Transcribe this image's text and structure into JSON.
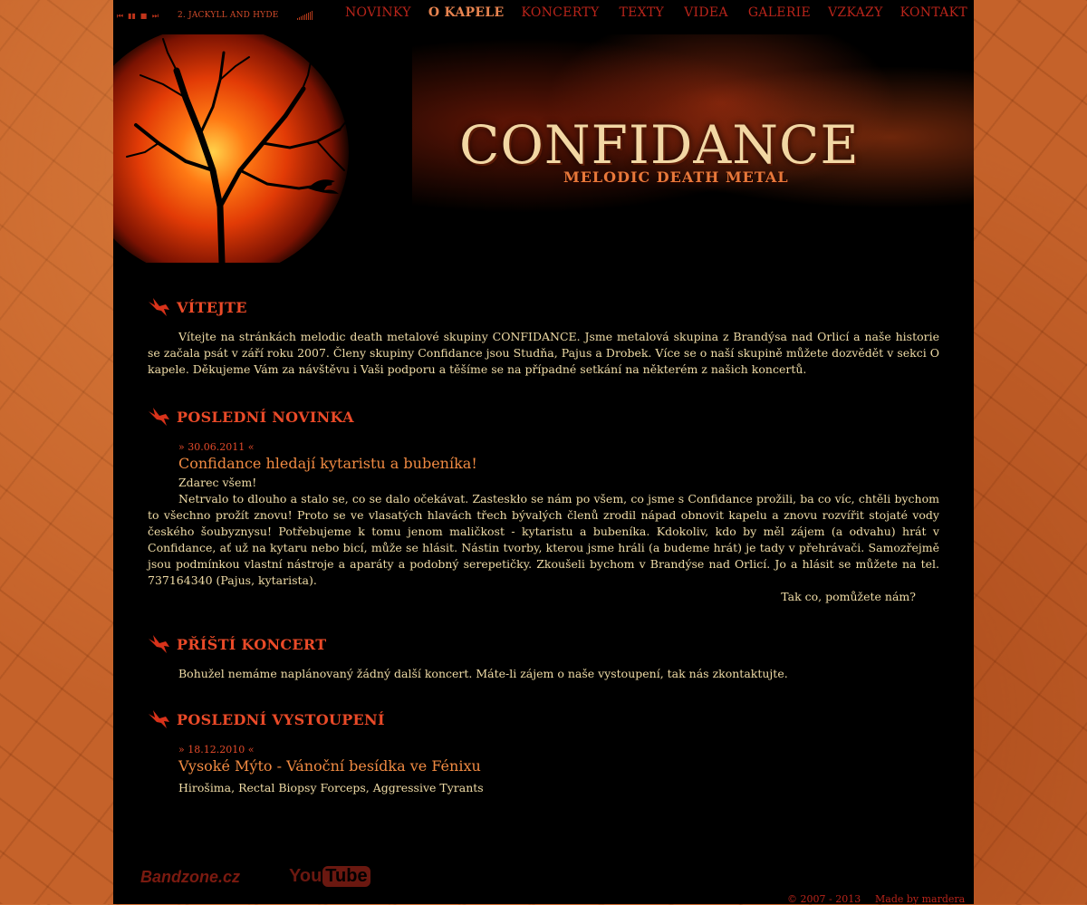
{
  "player": {
    "buttons": [
      "prev",
      "play",
      "stop",
      "next"
    ],
    "track": "2. JACKYLL AND HYDE"
  },
  "nav": [
    "NOVINKY",
    "O KAPELE",
    "KONCERTY",
    "TEXTY",
    "VIDEA",
    "GALERIE",
    "VZKAZY",
    "KONTAKT"
  ],
  "nav_active": "O KAPELE",
  "banner": {
    "logo": "CONFIDANCE",
    "tagline": "MELODIC DEATH METAL"
  },
  "welcome": {
    "title": "VÍTEJTE",
    "text": "Vítejte na stránkách melodic death metalové skupiny CONFIDANCE. Jsme metalová skupina z Brandýsa nad Orlicí a naše historie se začala psát v září roku 2007. Členy skupiny Confidance jsou Studňa, Pajus a Drobek. Více se o naší skupině můžete dozvědět v sekci O kapele. Děkujeme Vám za návštěvu i Vaši podporu a těšíme se na případné setkání na některém z našich koncertů."
  },
  "news": {
    "title": "POSLEDNÍ NOVINKA",
    "date": "» 30.06.2011 «",
    "headline": "Confidance hledají kytaristu a bubeníka!",
    "greeting": "Zdarec všem!",
    "body": "Netrvalo to dlouho a stalo se, co se dalo očekávat. Zasteskło se nám po všem, co jsme s Confidance prožili, ba co víc, chtěli bychom to všechno prožít znovu! Proto se ve vlasatých hlavách třech bývalých členů zrodil nápad obnovit kapelu a znovu rozvířit stojaté vody českého šoubyznysu! Potřebujeme k tomu jenom maličkost - kytaristu a bubeníka. Kdokoliv, kdo by měl zájem (a odvahu) hrát v Confidance, ať už na kytaru nebo bicí, může se hlásit. Nástin tvorby, kterou jsme hráli (a budeme hrát) je tady v přehrávači. Samozřejmě jsou podmínkou vlastní nástroje a aparáty a podobný serepetičky. Zkoušeli bychom v Brandýse nad Orlicí. Jo a hlásit se můžete na tel. 737164340 (Pajus, kytarista).",
    "closing": "Tak co, pomůžete nám?"
  },
  "next_concert": {
    "title": "PŘÍŠTÍ KONCERT",
    "text": "Bohužel nemáme naplánovaný žádný další koncert. Máte-li zájem o naše vystoupení, tak nás zkontaktujte."
  },
  "last_show": {
    "title": "POSLEDNÍ VYSTOUPENÍ",
    "date": "» 18.12.2010 «",
    "headline": "Vysoké Mýto - Vánoční besídka ve Fénixu",
    "bands": "Hirošima, Rectal Biopsy Forceps, Aggressive Tyrants"
  },
  "footer": {
    "bandzone": "Bandzone.cz",
    "youtube_you": "You",
    "youtube_tube": "Tube",
    "copyright": "© 2007 - 2013",
    "made_by": "Made by mardera"
  },
  "colors": {
    "page_bg": "#000000",
    "outer_bg": "#c5622a",
    "heading": "#ea4a28",
    "body_text": "#f0dca6",
    "link": "#f08a42",
    "nav": "#b8241a"
  }
}
